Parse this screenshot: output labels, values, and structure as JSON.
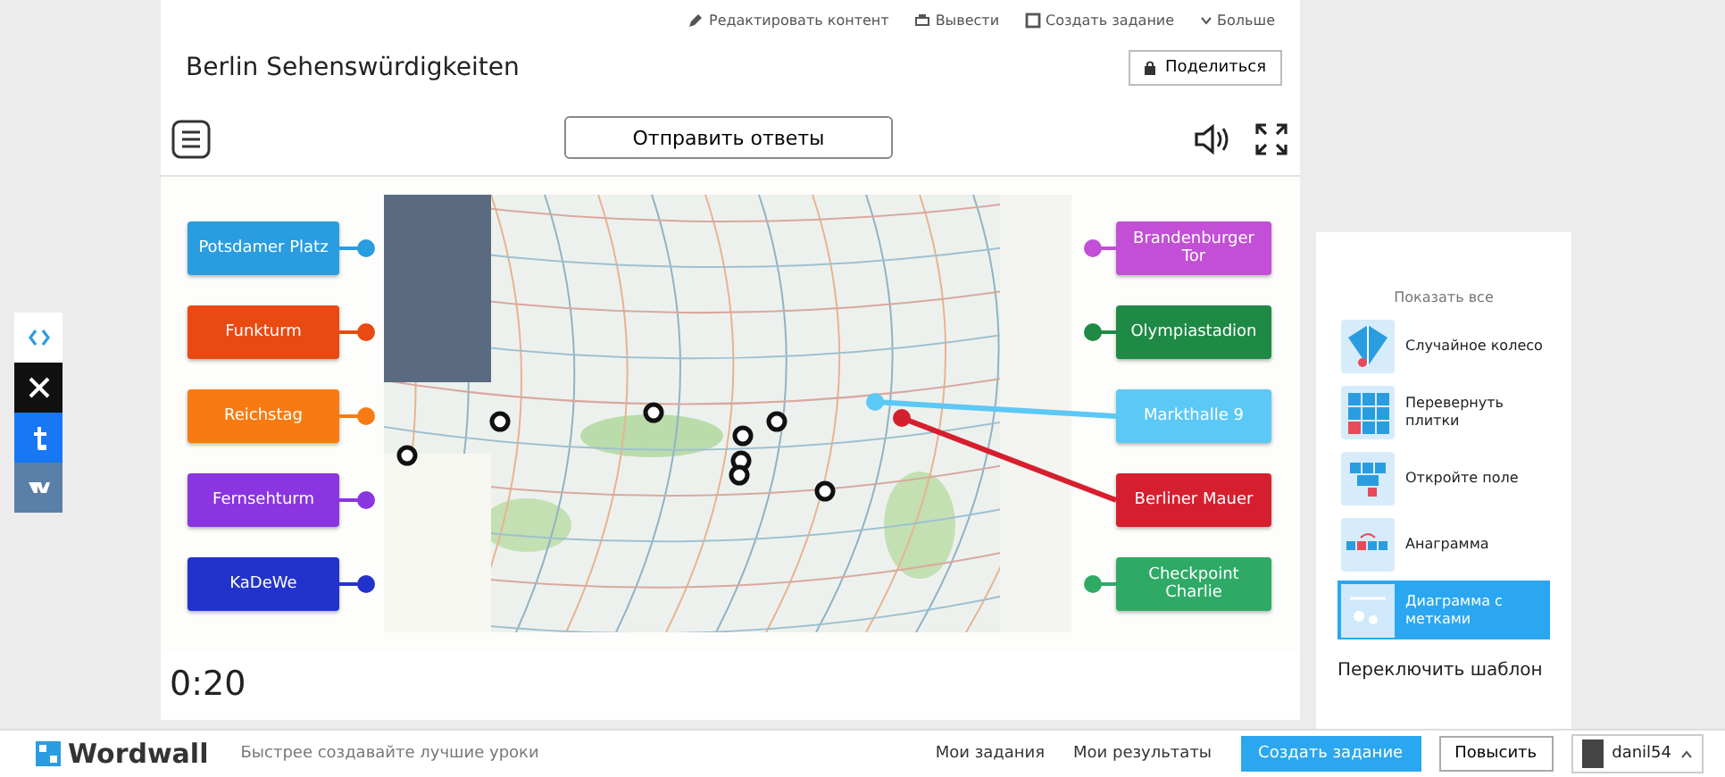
{
  "activity": {
    "actions": [
      {
        "kind": "edit",
        "label": "Редактировать контент"
      },
      {
        "kind": "print",
        "label": "Вывести"
      },
      {
        "kind": "create",
        "label": "Создать задание"
      },
      {
        "kind": "more",
        "label": "Больше"
      }
    ],
    "title": "Berlin Sehenswürdigkeiten",
    "share_button": "Поделиться",
    "submit_button": "Отправить ответы",
    "left_labels": [
      {
        "text": "Potsdamer Platz",
        "color": "#2a9de0",
        "placed": false
      },
      {
        "text": "Funkturm",
        "color": "#e84a12",
        "placed": false
      },
      {
        "text": "Reichstag",
        "color": "#f77b12",
        "placed": false
      },
      {
        "text": "Fernsehturm",
        "color": "#8a35e0",
        "placed": false
      },
      {
        "text": "KaDeWe",
        "color": "#2233cc",
        "placed": false
      }
    ],
    "right_labels": [
      {
        "text": "Brandenburger Tor",
        "color": "#c24fd6",
        "placed": false
      },
      {
        "text": "Olympiastadion",
        "color": "#1f8a45",
        "placed": false
      },
      {
        "text": "Markthalle 9",
        "color": "#5cc8f5",
        "placed": true
      },
      {
        "text": "Berliner Mauer",
        "color": "#d61f2e",
        "placed": true
      },
      {
        "text": "Checkpoint Charlie",
        "color": "#2eaa66",
        "placed": false
      }
    ],
    "timer": "0:20"
  },
  "share_buttons": [
    {
      "kind": "embed"
    },
    {
      "kind": "x"
    },
    {
      "kind": "tumblr"
    },
    {
      "kind": "vk"
    }
  ],
  "template_panel": {
    "show_all": "Показать все",
    "items": [
      {
        "kind": "wheel",
        "label": "Случайное колесо",
        "selected": false
      },
      {
        "kind": "tiles",
        "label": "Перевернуть плитки",
        "selected": false
      },
      {
        "kind": "open-box",
        "label": "Откройте поле",
        "selected": false
      },
      {
        "kind": "anagram",
        "label": "Анаграмма",
        "selected": false
      },
      {
        "kind": "diagram",
        "label": "Диаграмма с метками",
        "selected": true
      }
    ],
    "title": "Переключить шаблон"
  },
  "top_bar": {
    "logo": "Wordwall",
    "tagline": "Быстрее создавайте лучшие уроки",
    "links": [
      "Мои задания",
      "Мои результаты"
    ],
    "create_button": "Создать задание",
    "upgrade_button": "Повысить",
    "user": "danil54"
  }
}
